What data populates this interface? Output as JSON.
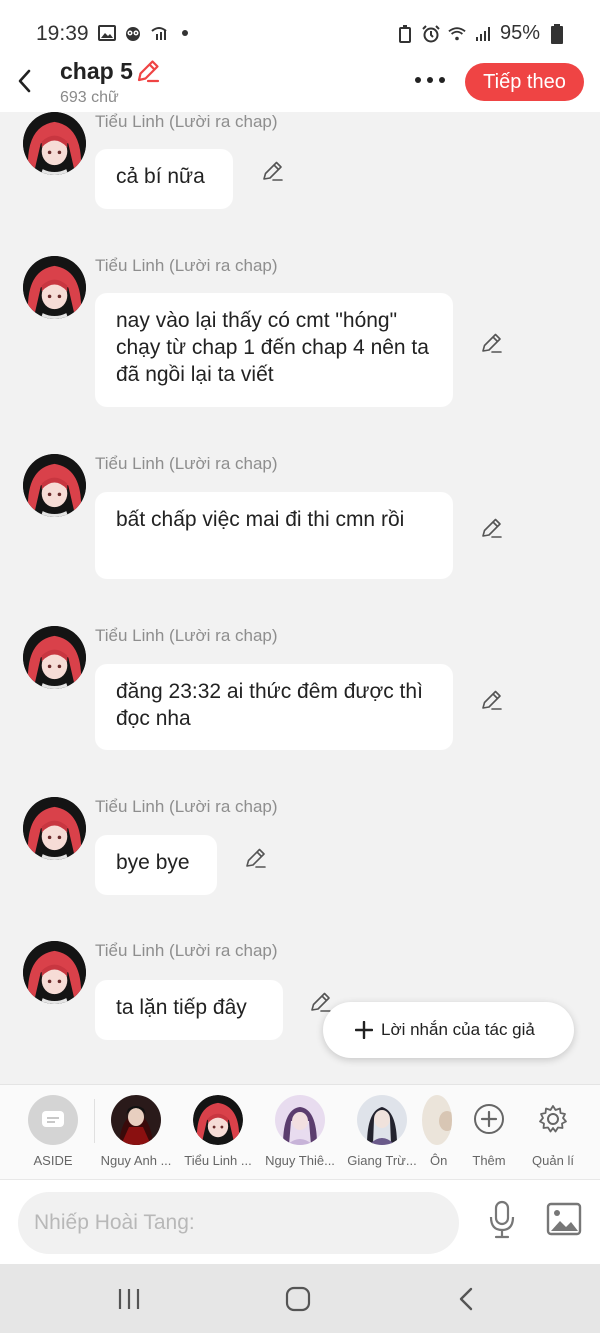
{
  "status_bar": {
    "time": "19:39",
    "battery": "95%"
  },
  "header": {
    "title": "chap 5",
    "word_count": "693 chữ",
    "next_label": "Tiếp theo"
  },
  "accent_color": "#ef4444",
  "messages": [
    {
      "sender": "Tiểu Linh (Lười ra chap)",
      "text": "cả bí nữa"
    },
    {
      "sender": "Tiểu Linh (Lười ra chap)",
      "text": "nay vào lại thấy có cmt \"hóng\" chạy từ chap 1 đến chap 4 nên ta đã ngồi lại ta viết"
    },
    {
      "sender": "Tiểu Linh (Lười ra chap)",
      "text": "bất chấp việc mai đi thi cmn rồi"
    },
    {
      "sender": "Tiểu Linh (Lười ra chap)",
      "text": "đăng 23:32 ai thức đêm được thì đọc nha"
    },
    {
      "sender": "Tiểu Linh (Lười ra chap)",
      "text": "bye bye"
    },
    {
      "sender": "Tiểu Linh (Lười ra chap)",
      "text": "ta lặn tiếp đây"
    }
  ],
  "fab": {
    "label": "Lời nhắn của tác giả"
  },
  "characters": [
    {
      "name": "ASIDE",
      "icon": "chat-bubble-icon"
    },
    {
      "name": "Nguy Anh ..."
    },
    {
      "name": "Tiểu Linh ..."
    },
    {
      "name": "Nguy Thiê..."
    },
    {
      "name": "Giang Trừ..."
    },
    {
      "name": "Ôn"
    }
  ],
  "actions": {
    "add_label": "Thêm",
    "manage_label": "Quản lí"
  },
  "input": {
    "placeholder": "Nhiếp Hoài Tang:"
  }
}
